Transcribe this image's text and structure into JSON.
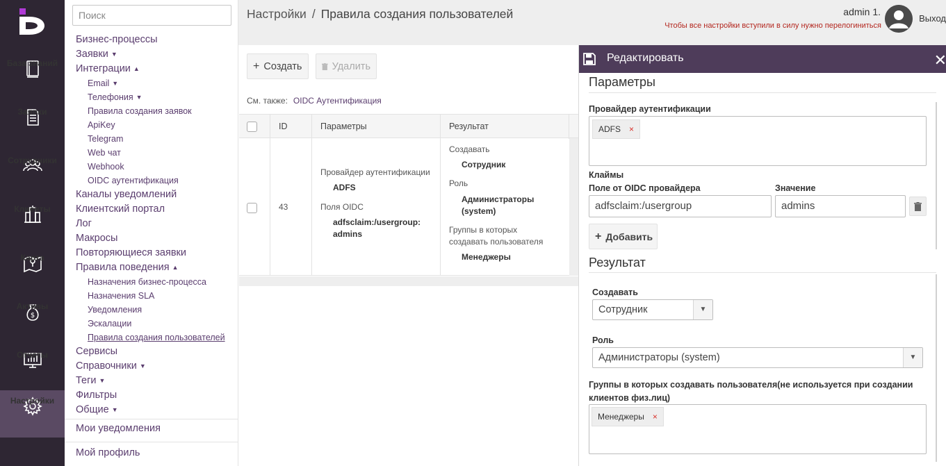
{
  "rail": {
    "items": [
      {
        "label": "База знаний",
        "icon": "book-icon"
      },
      {
        "label": "Заявки",
        "icon": "document-icon"
      },
      {
        "label": "Сотрудники",
        "icon": "users-icon"
      },
      {
        "label": "Клиенты",
        "icon": "buildings-icon"
      },
      {
        "label": "Карта",
        "icon": "map-icon"
      },
      {
        "label": "Активы",
        "icon": "money-bag-icon"
      },
      {
        "label": "Отчеты",
        "icon": "chart-monitor-icon"
      },
      {
        "label": "Настройки",
        "icon": "gear-icon"
      }
    ]
  },
  "menu": {
    "search_placeholder": "Поиск",
    "items": [
      {
        "label": "Бизнес-процессы",
        "sub": false,
        "caret": ""
      },
      {
        "label": "Заявки",
        "sub": false,
        "caret": "▼"
      },
      {
        "label": "Интеграции",
        "sub": false,
        "caret": "▲"
      },
      {
        "label": "Email",
        "sub": true,
        "caret": "▼"
      },
      {
        "label": "Телефония",
        "sub": true,
        "caret": "▼"
      },
      {
        "label": "Правила создания заявок",
        "sub": true,
        "caret": ""
      },
      {
        "label": "ApiKey",
        "sub": true,
        "caret": ""
      },
      {
        "label": "Telegram",
        "sub": true,
        "caret": ""
      },
      {
        "label": "Web чат",
        "sub": true,
        "caret": ""
      },
      {
        "label": "Webhook",
        "sub": true,
        "caret": ""
      },
      {
        "label": "OIDC аутентификация",
        "sub": true,
        "caret": ""
      },
      {
        "label": "Каналы уведомлений",
        "sub": false,
        "caret": ""
      },
      {
        "label": "Клиентский портал",
        "sub": false,
        "caret": ""
      },
      {
        "label": "Лог",
        "sub": false,
        "caret": ""
      },
      {
        "label": "Макросы",
        "sub": false,
        "caret": ""
      },
      {
        "label": "Повторяющиеся заявки",
        "sub": false,
        "caret": ""
      },
      {
        "label": "Правила поведения",
        "sub": false,
        "caret": "▲"
      },
      {
        "label": "Назначения бизнес-процесса",
        "sub": true,
        "caret": ""
      },
      {
        "label": "Назначения SLA",
        "sub": true,
        "caret": ""
      },
      {
        "label": "Уведомления",
        "sub": true,
        "caret": ""
      },
      {
        "label": "Эскалации",
        "sub": true,
        "caret": ""
      },
      {
        "label": "Правила создания пользователей",
        "sub": true,
        "caret": "",
        "current": true
      },
      {
        "label": "Сервисы",
        "sub": false,
        "caret": ""
      },
      {
        "label": "Справочники",
        "sub": false,
        "caret": "▼"
      },
      {
        "label": "Теги",
        "sub": false,
        "caret": "▼"
      },
      {
        "label": "Фильтры",
        "sub": false,
        "caret": ""
      },
      {
        "label": "Общие",
        "sub": false,
        "caret": "▼"
      }
    ],
    "notifications": "Мои уведомления",
    "profile": "Мой профиль"
  },
  "header": {
    "crumb_root": "Настройки",
    "crumb_sep": "/",
    "crumb_current": "Правила создания пользователей",
    "user": "admin 1.",
    "restart_note": "Чтобы все настройки вступили в силу нужно перелогиниться",
    "logout": "Выход"
  },
  "toolbar": {
    "create": "Создать",
    "delete": "Удалить",
    "see_also": "См. также:",
    "see_also_link": "OIDC Аутентификация"
  },
  "table": {
    "columns": [
      "ID",
      "Параметры",
      "Результат"
    ],
    "row": {
      "id": "43",
      "params": {
        "provider_label": "Провайдер аутентификации",
        "provider_value": "ADFS",
        "fields_label": "Поля OIDC",
        "fields_value_1": "adfsclaim:/usergroup:",
        "fields_value_2": "admins"
      },
      "result": {
        "create_label": "Создавать",
        "create_value": "Сотрудник",
        "role_label": "Роль",
        "role_value_1": "Администраторы",
        "role_value_2": "(system)",
        "groups_label_1": "Группы в которых",
        "groups_label_2": "создавать пользователя",
        "groups_value": "Менеджеры"
      }
    }
  },
  "panel": {
    "title": "Редактировать",
    "params_title": "Параметры",
    "provider_label": "Провайдер аутентификации",
    "provider_tag": "ADFS",
    "tag_remove": "×",
    "claims_label": "Клаймы",
    "claim_field_label": "Поле от OIDC провайдера",
    "claim_value_label": "Значение",
    "claim_field_value": "adfsclaim:/usergroup",
    "claim_value_value": "admins",
    "add_button": "Добавить",
    "result_title": "Результат",
    "create_label": "Создавать",
    "create_value": "Сотрудник",
    "role_label": "Роль",
    "role_value": "Администраторы (system)",
    "groups_label_1": "Группы в которых создавать пользователя(не используется при создании",
    "groups_label_2": "клиентов физ.лиц)",
    "groups_tag": "Менеджеры"
  },
  "colors": {
    "rail_bg": "#2e2633",
    "rail_active": "#5a4a63",
    "panel_header": "#4e3c5a",
    "link": "#5a3d6e",
    "warning": "#b3261e"
  }
}
